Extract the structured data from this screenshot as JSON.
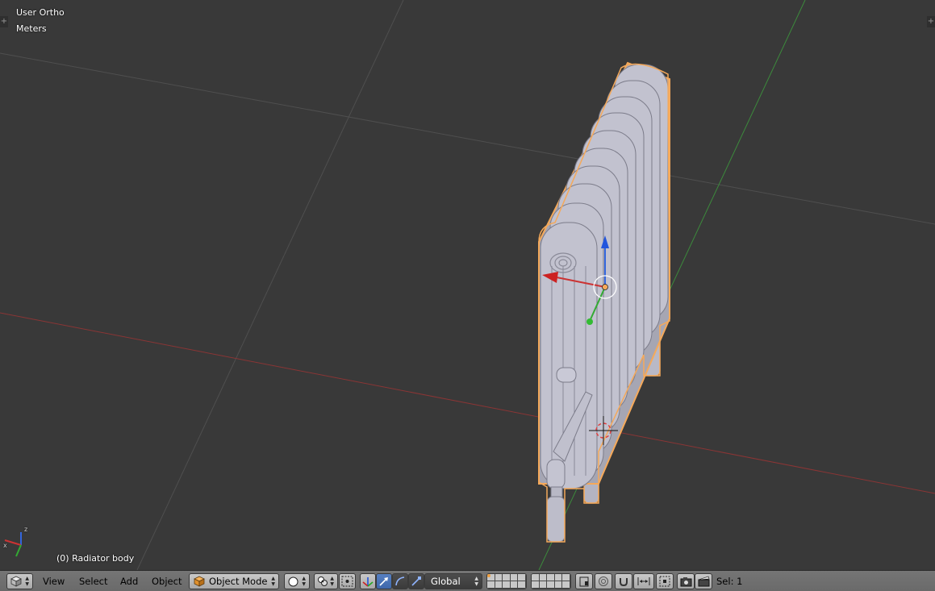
{
  "viewport": {
    "view_name": "User Ortho",
    "units": "Meters",
    "object_info": "(0) Radiator body",
    "mini_axes": {
      "x": "x",
      "z": "z"
    }
  },
  "header": {
    "editor_type_icon": "cube-icon",
    "menus": [
      "View",
      "Select",
      "Add",
      "Object"
    ],
    "mode": {
      "label": "Object Mode",
      "icon": "object-mode-cube-icon"
    },
    "shading_icon": "solid-shading-sphere-icon",
    "pivot_icon": "pivot-point-icon",
    "manipulator_icon": "manipulator-toggle-icon",
    "transform_icons": [
      "translate-icon",
      "rotate-icon",
      "scale-icon"
    ],
    "orientation": "Global",
    "status": "Sel: 1"
  },
  "colors": {
    "viewport_bg": "#393939",
    "x_axis": "#cc3333",
    "y_axis": "#33aa33",
    "z_axis": "#3366dd",
    "selection_outline": "#f5a95a",
    "header_bg": "#727272"
  }
}
